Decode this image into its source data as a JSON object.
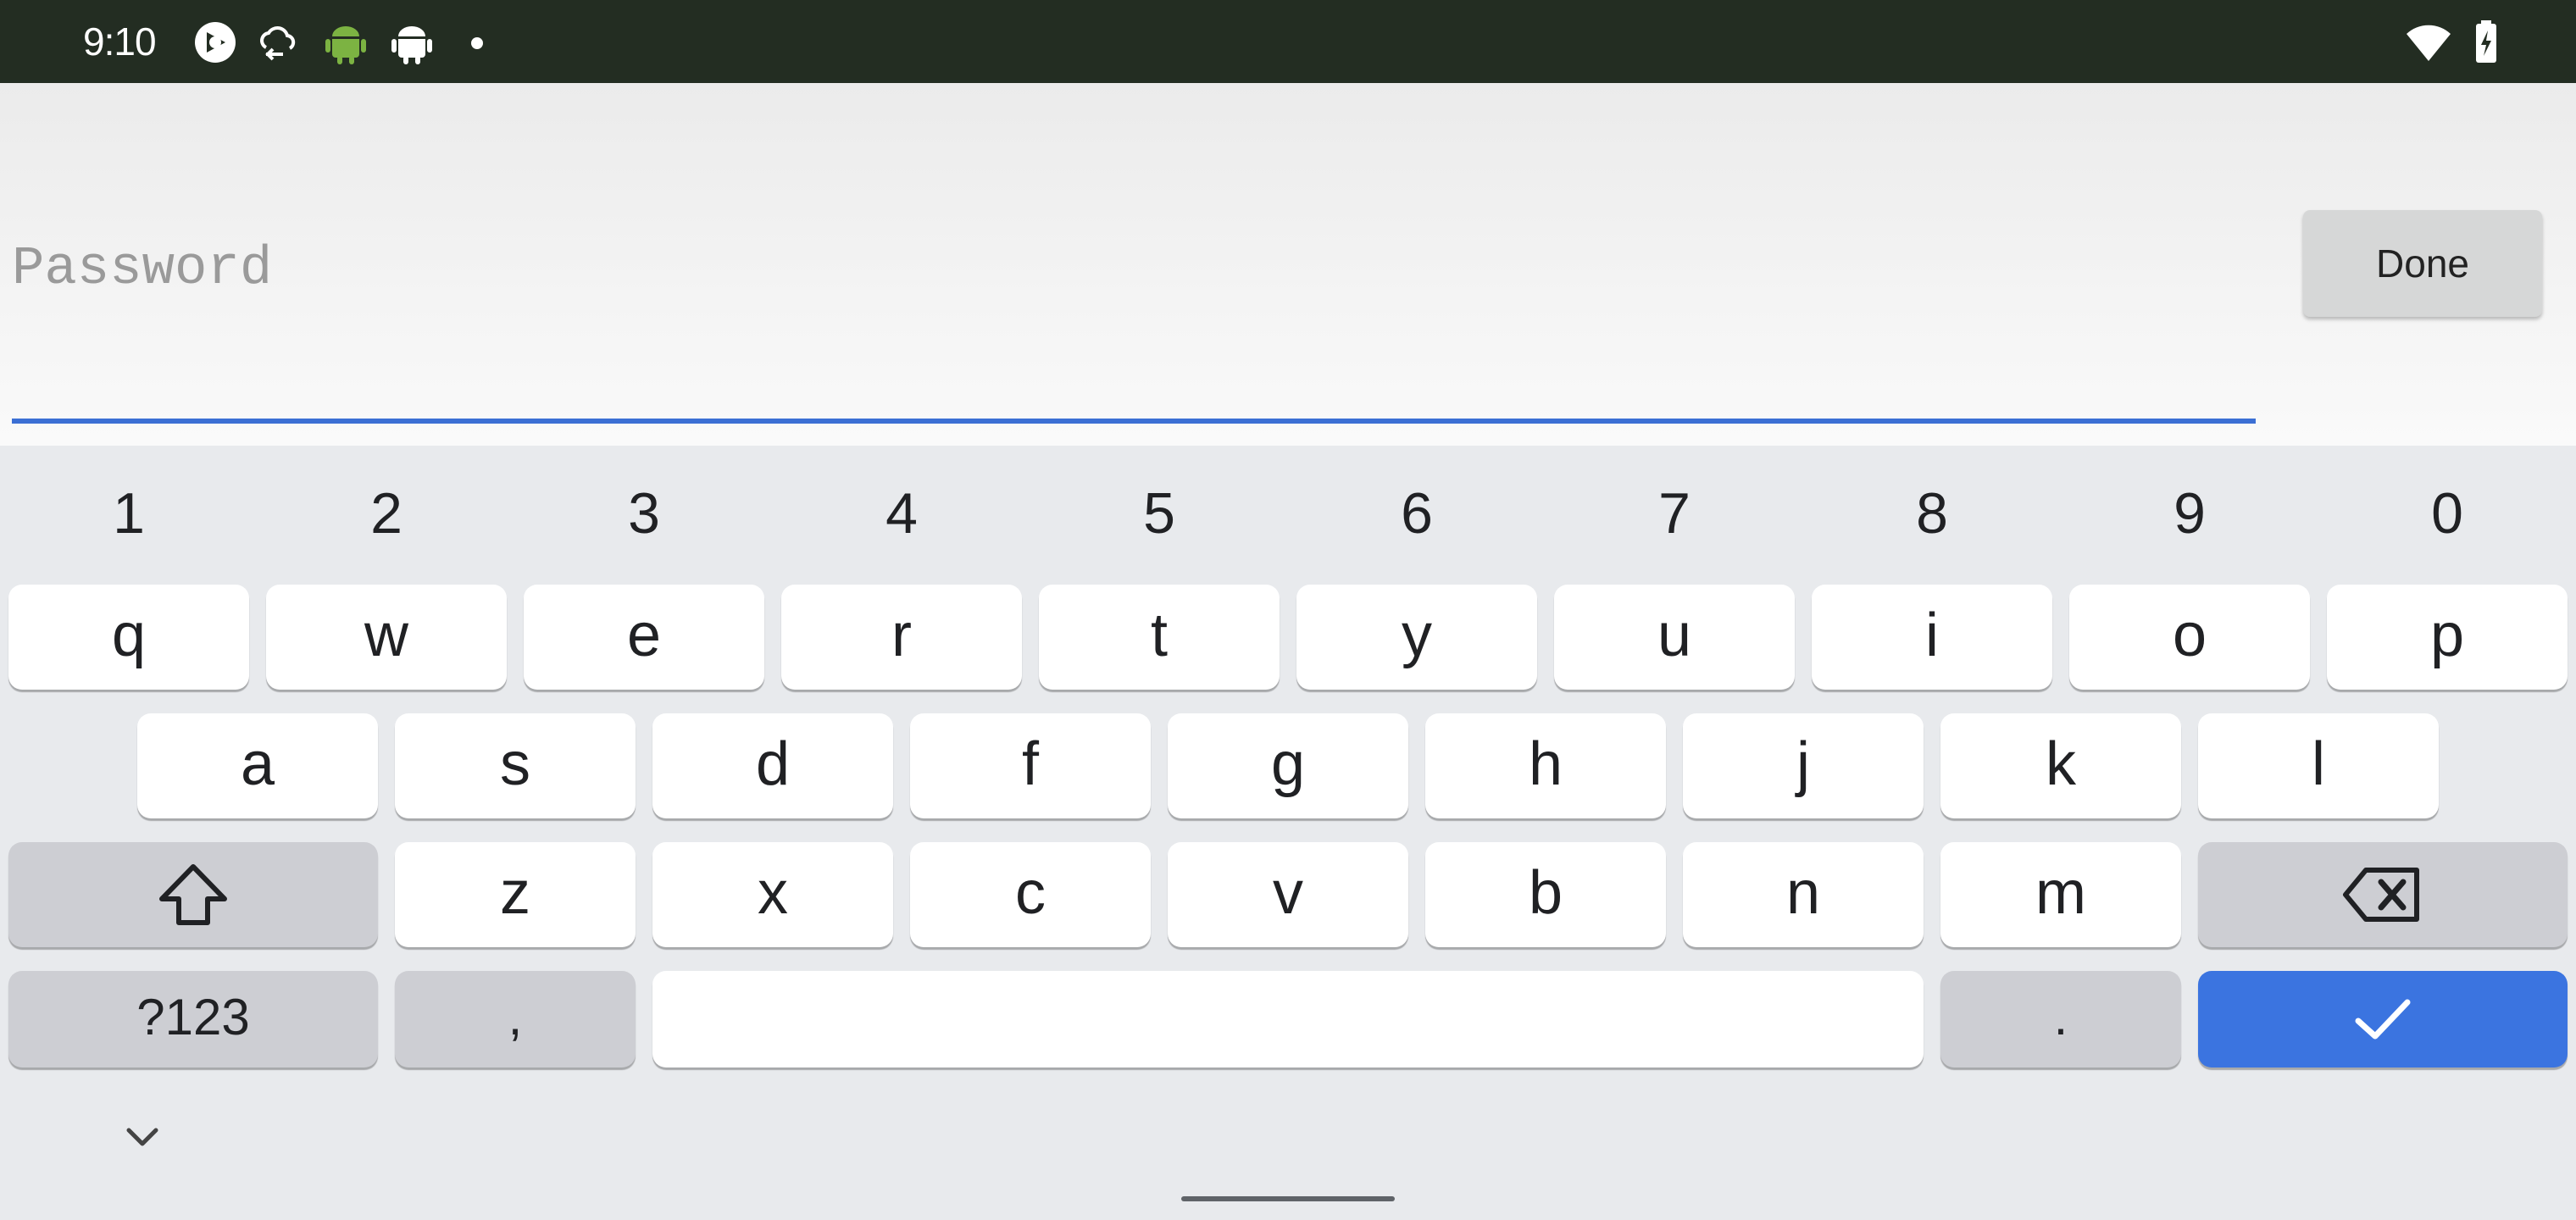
{
  "status_bar": {
    "time": "9:10",
    "icons": [
      "photo-app-icon",
      "cloud-sync-icon",
      "android-icon",
      "android-debug-icon",
      "notification-dot-icon",
      "wifi-icon",
      "battery-charging-icon"
    ]
  },
  "input": {
    "placeholder": "Password",
    "value": "",
    "done_label": "Done",
    "underline_color": "#3b6fd4"
  },
  "keyboard": {
    "numbers": [
      "1",
      "2",
      "3",
      "4",
      "5",
      "6",
      "7",
      "8",
      "9",
      "0"
    ],
    "row1": [
      "q",
      "w",
      "e",
      "r",
      "t",
      "y",
      "u",
      "i",
      "o",
      "p"
    ],
    "row2": [
      "a",
      "s",
      "d",
      "f",
      "g",
      "h",
      "j",
      "k",
      "l"
    ],
    "row3": [
      "z",
      "x",
      "c",
      "v",
      "b",
      "n",
      "m"
    ],
    "symbols_label": "?123",
    "comma_label": ",",
    "period_label": ".",
    "enter_color": "#3b74e0"
  }
}
